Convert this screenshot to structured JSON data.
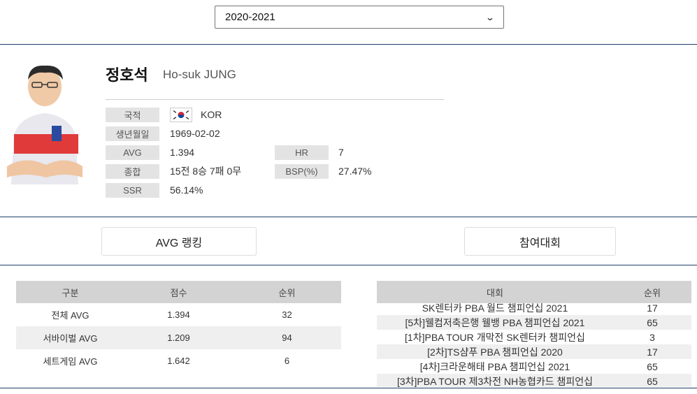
{
  "season": {
    "selected": "2020-2021"
  },
  "player": {
    "name_ko": "정호석",
    "name_en": "Ho-suk JUNG",
    "fields": {
      "nationality_label": "국적",
      "nationality_value": "KOR",
      "birth_label": "생년월일",
      "birth_value": "1969-02-02",
      "avg_label": "AVG",
      "avg_value": "1.394",
      "hr_label": "HR",
      "hr_value": "7",
      "record_label": "종합",
      "record_value": "15전 8승 7패 0무",
      "bsp_label": "BSP(%)",
      "bsp_value": "27.47%",
      "ssr_label": "SSR",
      "ssr_value": "56.14%"
    }
  },
  "buttons": {
    "avg_ranking": "AVG 랭킹",
    "tournaments": "참여대회"
  },
  "avg_table": {
    "headers": [
      "구분",
      "점수",
      "순위"
    ],
    "rows": [
      [
        "전체 AVG",
        "1.394",
        "32"
      ],
      [
        "서바이벌 AVG",
        "1.209",
        "94"
      ],
      [
        "세트게임 AVG",
        "1.642",
        "6"
      ]
    ]
  },
  "tournament_table": {
    "headers": [
      "대회",
      "순위"
    ],
    "rows": [
      [
        "SK렌터카 PBA 월드 챔피언십 2021",
        "17"
      ],
      [
        "[5차]웰컴저축은행 웰뱅 PBA 챔피언십 2021",
        "65"
      ],
      [
        "[1차]PBA TOUR 개막전 SK렌터카 챔피언십",
        "3"
      ],
      [
        "[2차]TS샴푸 PBA 챔피언십 2020",
        "17"
      ],
      [
        "[4차]크라운해태 PBA 챔피언십 2021",
        "65"
      ],
      [
        "[3차]PBA TOUR 제3차전 NH농협카드 챔피언십",
        "65"
      ]
    ]
  },
  "colors": {
    "rule": "#1c3f66",
    "label_bg": "#e3e3e3",
    "header_bg": "#d3d3d3",
    "stripe": "#efefef"
  }
}
